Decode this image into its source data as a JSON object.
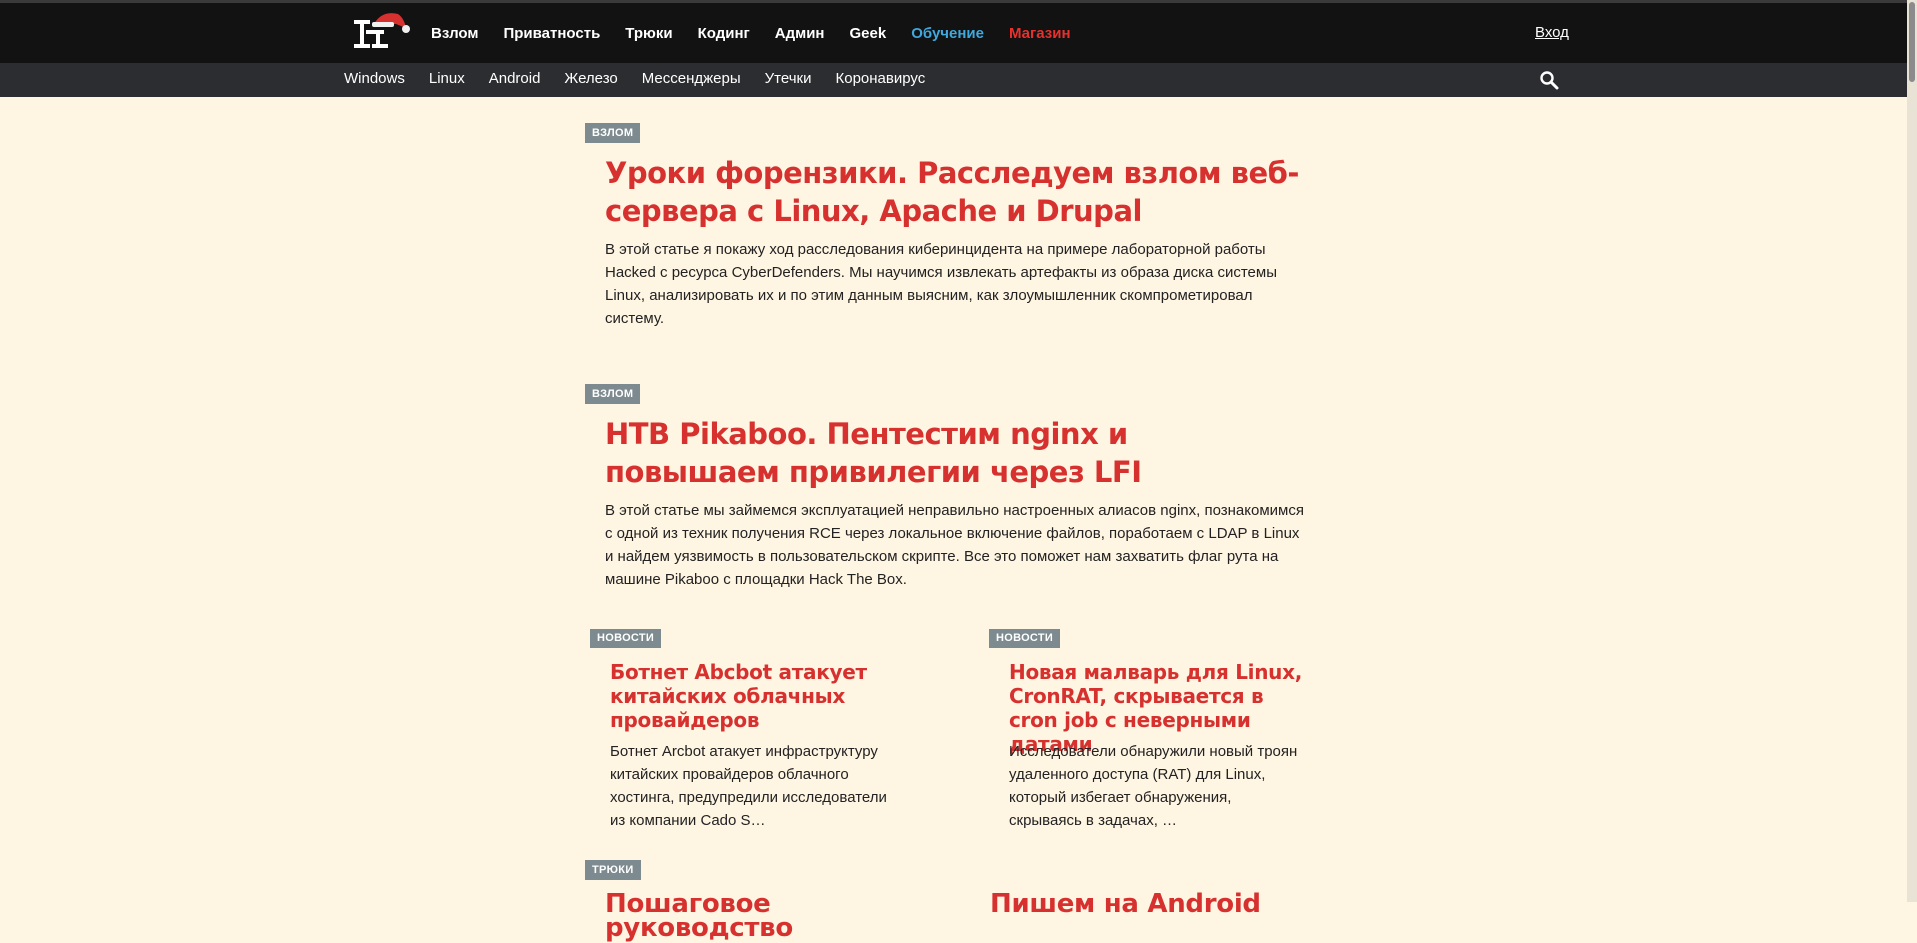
{
  "header": {
    "nav": [
      "Взлом",
      "Приватность",
      "Трюки",
      "Кодинг",
      "Админ",
      "Geek",
      "Обучение",
      "Магазин"
    ],
    "nav_colors": {
      "highlight": "#3fa8de",
      "shop": "#e8312f",
      "default": "#ffffff"
    },
    "login": "Вход"
  },
  "subnav": [
    "Windows",
    "Linux",
    "Android",
    "Железо",
    "Мессенджеры",
    "Утечки",
    "Коронавирус"
  ],
  "articles": [
    {
      "category": "взлом",
      "title": "Уроки форензики. Расследуем взлом веб-сервера с Linux, Apache и Drupal",
      "desc": "В этой статье я покажу ход расследования киберинцидента на примере лабораторной работы Hacked с ресурса CyberDefenders. Мы научимся извлекать артефакты из образа диска системы Linux, анализировать их и по этим данным выясним, как злоумышленник скомпрометировал систему."
    },
    {
      "category": "взлом",
      "title": "HTB Pikaboo. Пентестим nginx и повышаем привилегии через LFI",
      "desc": "В этой статье мы займемся эксплуатацией неправильно настроенных алиасов nginx, познакомимся с одной из техник получения RCE через локальное включение файлов, поработаем с LDAP в Linux и найдем уязвимость в пользовательском скрипте. Все это поможет нам захватить флаг рута на машине Pikaboo с площадки Hack The Box."
    }
  ],
  "news": [
    {
      "category": "новости",
      "title": "Ботнет Abcbot атакует китайских облачных провайдеров",
      "desc": "Ботнет Arcbot атакует инфраструктуру китайских провайдеров облачного хостинга, предупредили исследователи из компании Cado S…"
    },
    {
      "category": "новости",
      "title": "Новая малварь для Linux, CronRAT, скрывается в cron job с неверными датами",
      "desc": "Исследователи обнаружили новый троян удаленного доступа (RAT) для Linux, который избегает обнаружения, скрываясь в задачах, …"
    }
  ],
  "next": {
    "category": "трюки",
    "title_left": "Пошаговое руководство",
    "title_right": "Пишем на Android"
  }
}
